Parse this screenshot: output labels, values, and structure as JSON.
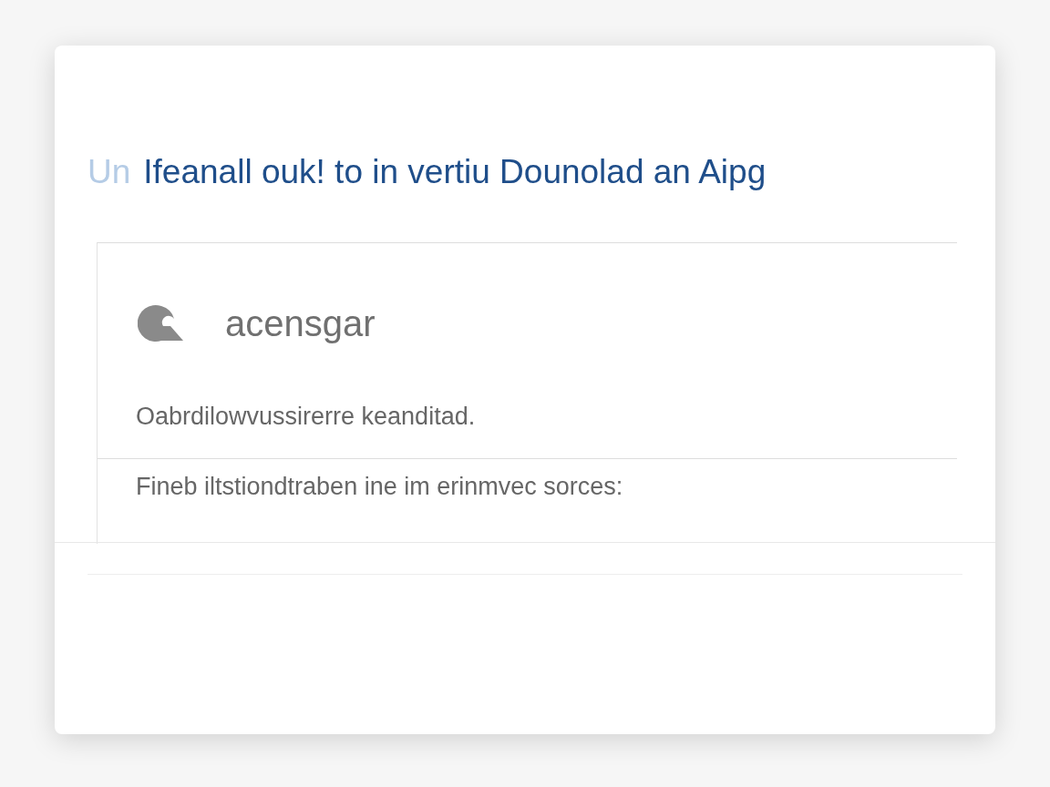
{
  "dialog": {
    "title_prefix": "Un",
    "title": "Ifeanall ouk! to in vertiu Dounolad an Aipg"
  },
  "panel": {
    "app_name": "acensgar",
    "lines": [
      "Oabrdilowvussirerre keanditad.",
      "Fineb iltstiondtraben ine im erinmvec sorces:"
    ]
  }
}
